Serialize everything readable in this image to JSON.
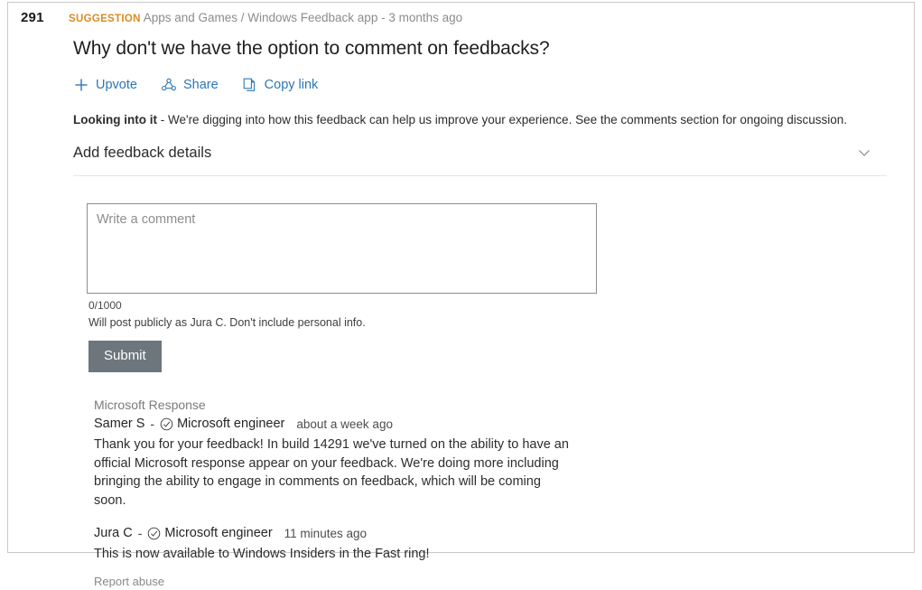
{
  "feedback": {
    "vote_count": "291",
    "category_tag": "SUGGESTION",
    "category_path": "Apps and Games / Windows Feedback app - 3 months ago",
    "title": "Why don't we have the option to comment on feedbacks?",
    "status_label": "Looking into it",
    "status_text": " - We're digging into how this feedback can help us improve your experience. See the comments section for ongoing discussion.",
    "details_toggle_label": "Add feedback details"
  },
  "actions": {
    "upvote_label": "Upvote",
    "share_label": "Share",
    "copy_link_label": "Copy link",
    "accent_color": "#2b77b8",
    "tag_color": "#d98c1f"
  },
  "composer": {
    "placeholder": "Write a comment",
    "value": "",
    "char_count": "0/1000",
    "post_notice": "Will post publicly as Jura C. Don't include personal info.",
    "submit_label": "Submit",
    "submit_color": "#6d767c"
  },
  "responses": {
    "header": "Microsoft Response",
    "items": [
      {
        "author": "Samer S",
        "dash": "-",
        "role": "Microsoft engineer",
        "time": "about a week ago",
        "body": "Thank you for your feedback!  In build 14291 we've turned on the ability to have an official Microsoft response appear on your feedback.  We're doing more including bringing the ability to engage in comments on feedback, which will be coming soon."
      },
      {
        "author": "Jura C",
        "dash": "-",
        "role": "Microsoft engineer",
        "time": "11 minutes ago",
        "body": "This is now available to Windows Insiders in the Fast ring!"
      }
    ],
    "report_abuse_label": "Report abuse"
  }
}
